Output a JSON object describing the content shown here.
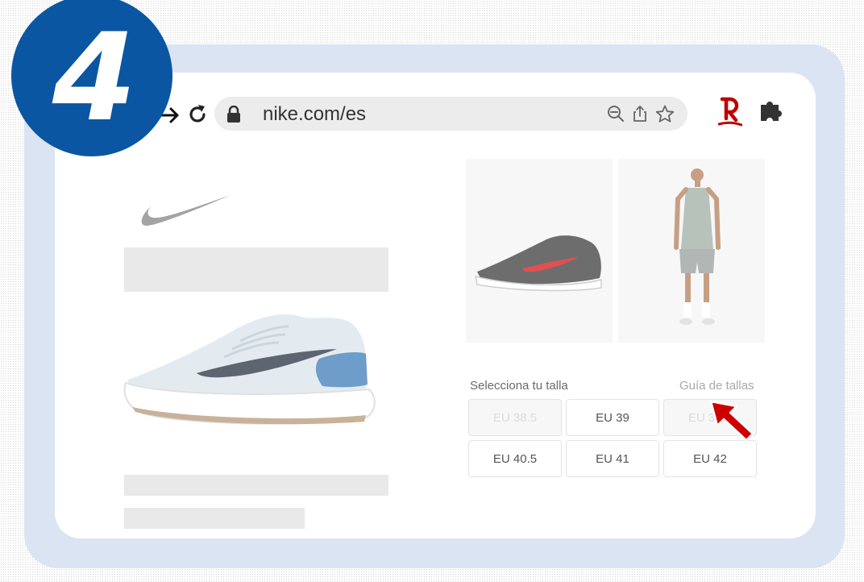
{
  "step": {
    "number": "4"
  },
  "browser": {
    "url": "nike.com/es",
    "icons": [
      "forward-arrow-icon",
      "reload-icon",
      "lock-icon",
      "zoom-out-icon",
      "share-icon",
      "star-icon",
      "rakuten-icon",
      "puzzle-icon"
    ]
  },
  "product": {
    "sizes": {
      "label": "Selecciona tu talla",
      "guide_link": "Guía de tallas",
      "options": [
        {
          "label": "EU 38.5",
          "available": false
        },
        {
          "label": "EU 39",
          "available": true
        },
        {
          "label": "EU 39.5",
          "available": false
        },
        {
          "label": "EU 40.5",
          "available": true
        },
        {
          "label": "EU 41",
          "available": true
        },
        {
          "label": "EU 42",
          "available": true
        }
      ]
    }
  },
  "colors": {
    "badge": "#0b56a2",
    "frame": "#dbe4f2",
    "rakuten_red": "#bf0000",
    "cursor_red": "#cc0000"
  }
}
